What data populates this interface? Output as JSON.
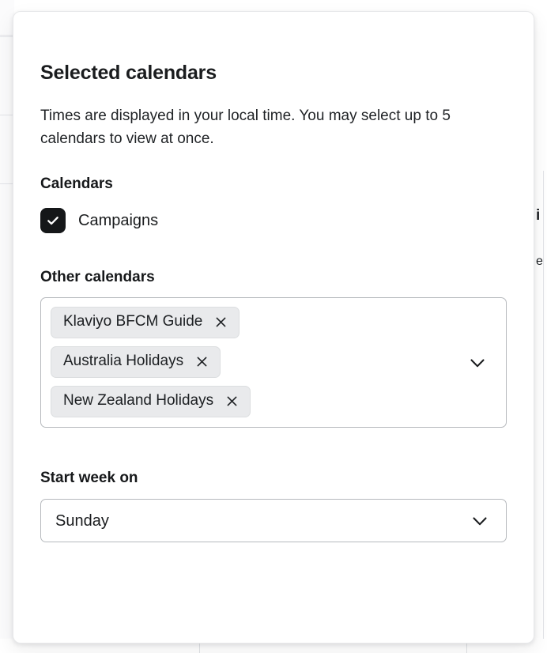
{
  "modal": {
    "title": "Selected calendars",
    "description": "Times are displayed in your local time. You may select up to 5 calendars to view at once.",
    "calendars_section": {
      "label": "Calendars",
      "items": [
        {
          "label": "Campaigns",
          "checked": true
        }
      ]
    },
    "other_calendars_section": {
      "label": "Other calendars",
      "chips": [
        {
          "label": "Klaviyo BFCM Guide",
          "remove_icon": "close-icon"
        },
        {
          "label": "Australia Holidays",
          "remove_icon": "close-icon"
        },
        {
          "label": "New Zealand Holidays",
          "remove_icon": "close-icon"
        }
      ],
      "dropdown_icon": "chevron-down-icon"
    },
    "start_week_section": {
      "label": "Start week on",
      "selected_value": "Sunday",
      "dropdown_icon": "chevron-down-icon"
    }
  },
  "icons": {
    "checkmark": "check-icon",
    "close": "close-icon",
    "chevron_down": "chevron-down-icon"
  },
  "colors": {
    "card_background": "#ffffff",
    "card_border": "#e7e8ea",
    "text_primary": "#1a1c1e",
    "text_body": "#1f2225",
    "chip_background": "#e9eaec",
    "chip_border": "#dcdee0",
    "control_border": "#b6b9bd",
    "checkbox_fill": "#151719",
    "page_divider": "#e3e4e8"
  },
  "background": {
    "clipped_text_top": "i",
    "clipped_text_bottom": "e",
    "divider_positions": [
      252,
      590
    ]
  }
}
